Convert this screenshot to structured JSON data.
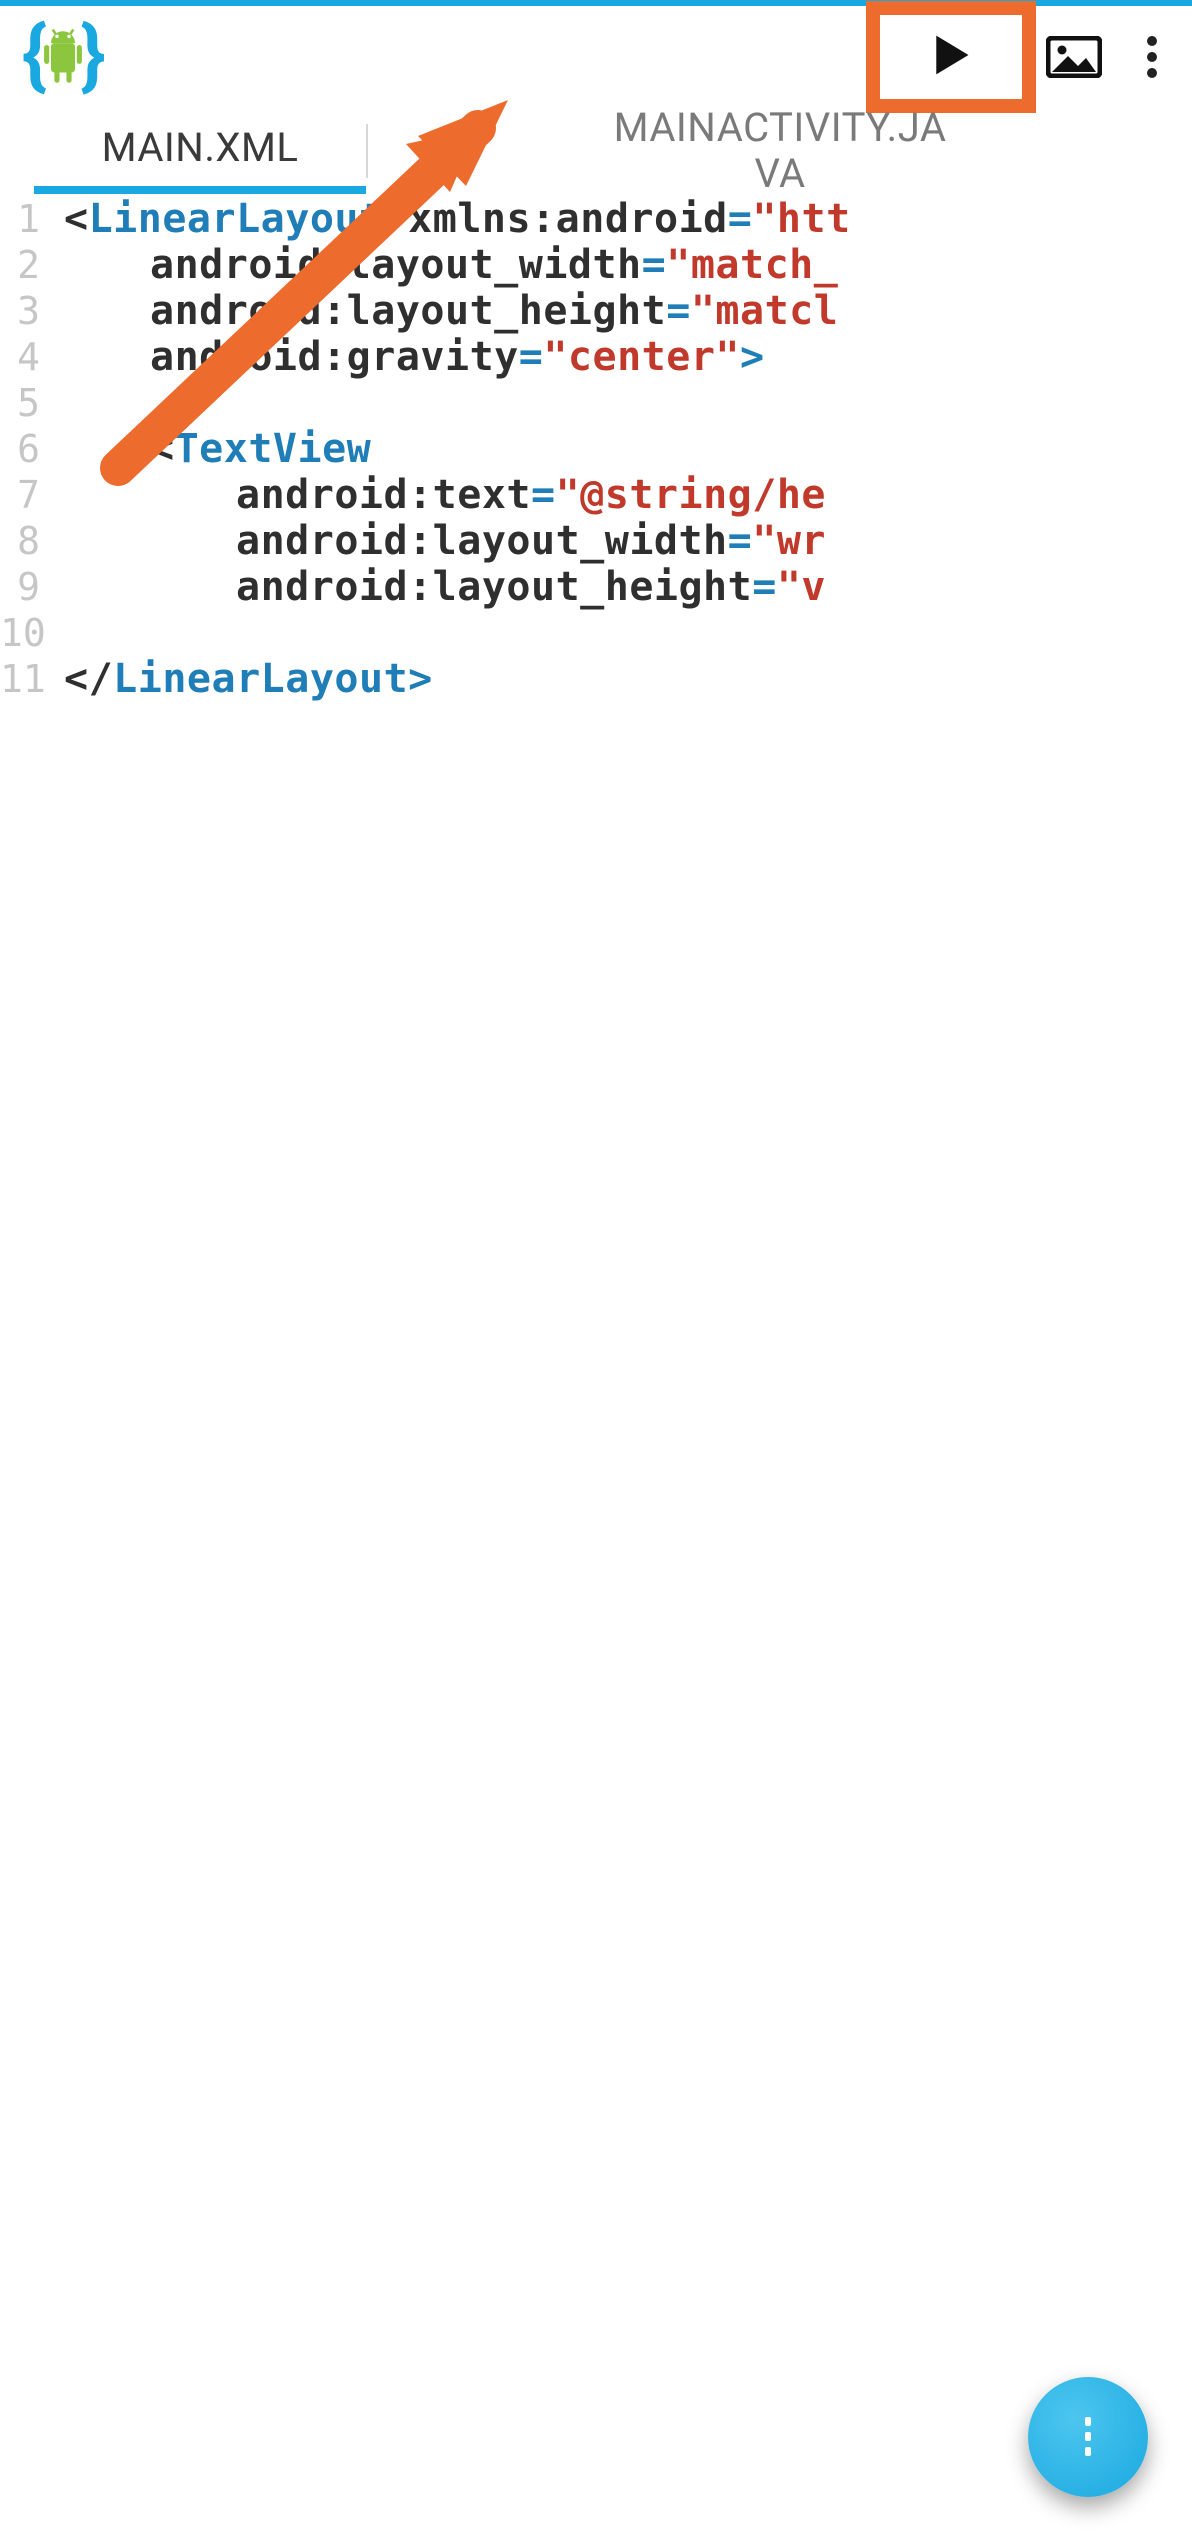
{
  "header": {
    "logo_name": "aide-android-logo",
    "run_button": {
      "icon": "play-icon"
    },
    "image_button": {
      "icon": "image-icon"
    },
    "overflow_button": {
      "icon": "overflow-menu-icon"
    }
  },
  "tabs": {
    "active": "MAIN.XML",
    "inactive_line1": "MAINACTIVITY.JA",
    "inactive_line2": "VA"
  },
  "annotations": {
    "highlight_color": "#ec6b2d",
    "arrow_target": "run-button"
  },
  "editor": {
    "lines": [
      {
        "n": "1",
        "indent": "ind1",
        "tokens": [
          {
            "t": "punct",
            "v": "<"
          },
          {
            "t": "tag",
            "v": "LinearLayout"
          },
          {
            "t": "punct",
            "v": " "
          },
          {
            "t": "attr",
            "v": "xmlns:android"
          },
          {
            "t": "eq",
            "v": "="
          },
          {
            "t": "str",
            "v": "\"htt"
          }
        ]
      },
      {
        "n": "2",
        "indent": "ind2",
        "tokens": [
          {
            "t": "attr",
            "v": "android:layout_width"
          },
          {
            "t": "eq",
            "v": "="
          },
          {
            "t": "str",
            "v": "\"match_"
          }
        ]
      },
      {
        "n": "3",
        "indent": "ind2",
        "tokens": [
          {
            "t": "attr",
            "v": "android:layout_height"
          },
          {
            "t": "eq",
            "v": "="
          },
          {
            "t": "str",
            "v": "\"matcl"
          }
        ]
      },
      {
        "n": "4",
        "indent": "ind2",
        "tokens": [
          {
            "t": "attr",
            "v": "android:gravity"
          },
          {
            "t": "eq",
            "v": "="
          },
          {
            "t": "str",
            "v": "\"center\""
          },
          {
            "t": "eq",
            "v": ">"
          }
        ]
      },
      {
        "n": "5",
        "indent": "ind1",
        "tokens": []
      },
      {
        "n": "6",
        "indent": "ind2",
        "tokens": [
          {
            "t": "punct",
            "v": "<"
          },
          {
            "t": "tag",
            "v": "TextView"
          }
        ]
      },
      {
        "n": "7",
        "indent": "ind3",
        "tokens": [
          {
            "t": "attr",
            "v": "android:text"
          },
          {
            "t": "eq",
            "v": "="
          },
          {
            "t": "str",
            "v": "\"@string/he"
          }
        ]
      },
      {
        "n": "8",
        "indent": "ind3",
        "tokens": [
          {
            "t": "attr",
            "v": "android:layout_width"
          },
          {
            "t": "eq",
            "v": "="
          },
          {
            "t": "str",
            "v": "\"wr"
          }
        ]
      },
      {
        "n": "9",
        "indent": "ind3",
        "tokens": [
          {
            "t": "attr",
            "v": "android:layout_height"
          },
          {
            "t": "eq",
            "v": "="
          },
          {
            "t": "str",
            "v": "\"v"
          }
        ]
      },
      {
        "n": "10",
        "indent": "ind1",
        "tokens": []
      },
      {
        "n": "11",
        "indent": "ind1",
        "tokens": [
          {
            "t": "punct",
            "v": "</"
          },
          {
            "t": "tag",
            "v": "LinearLayout"
          },
          {
            "t": "eq",
            "v": ">"
          }
        ]
      }
    ]
  },
  "fab": {
    "icon": "vertical-dots-icon"
  }
}
